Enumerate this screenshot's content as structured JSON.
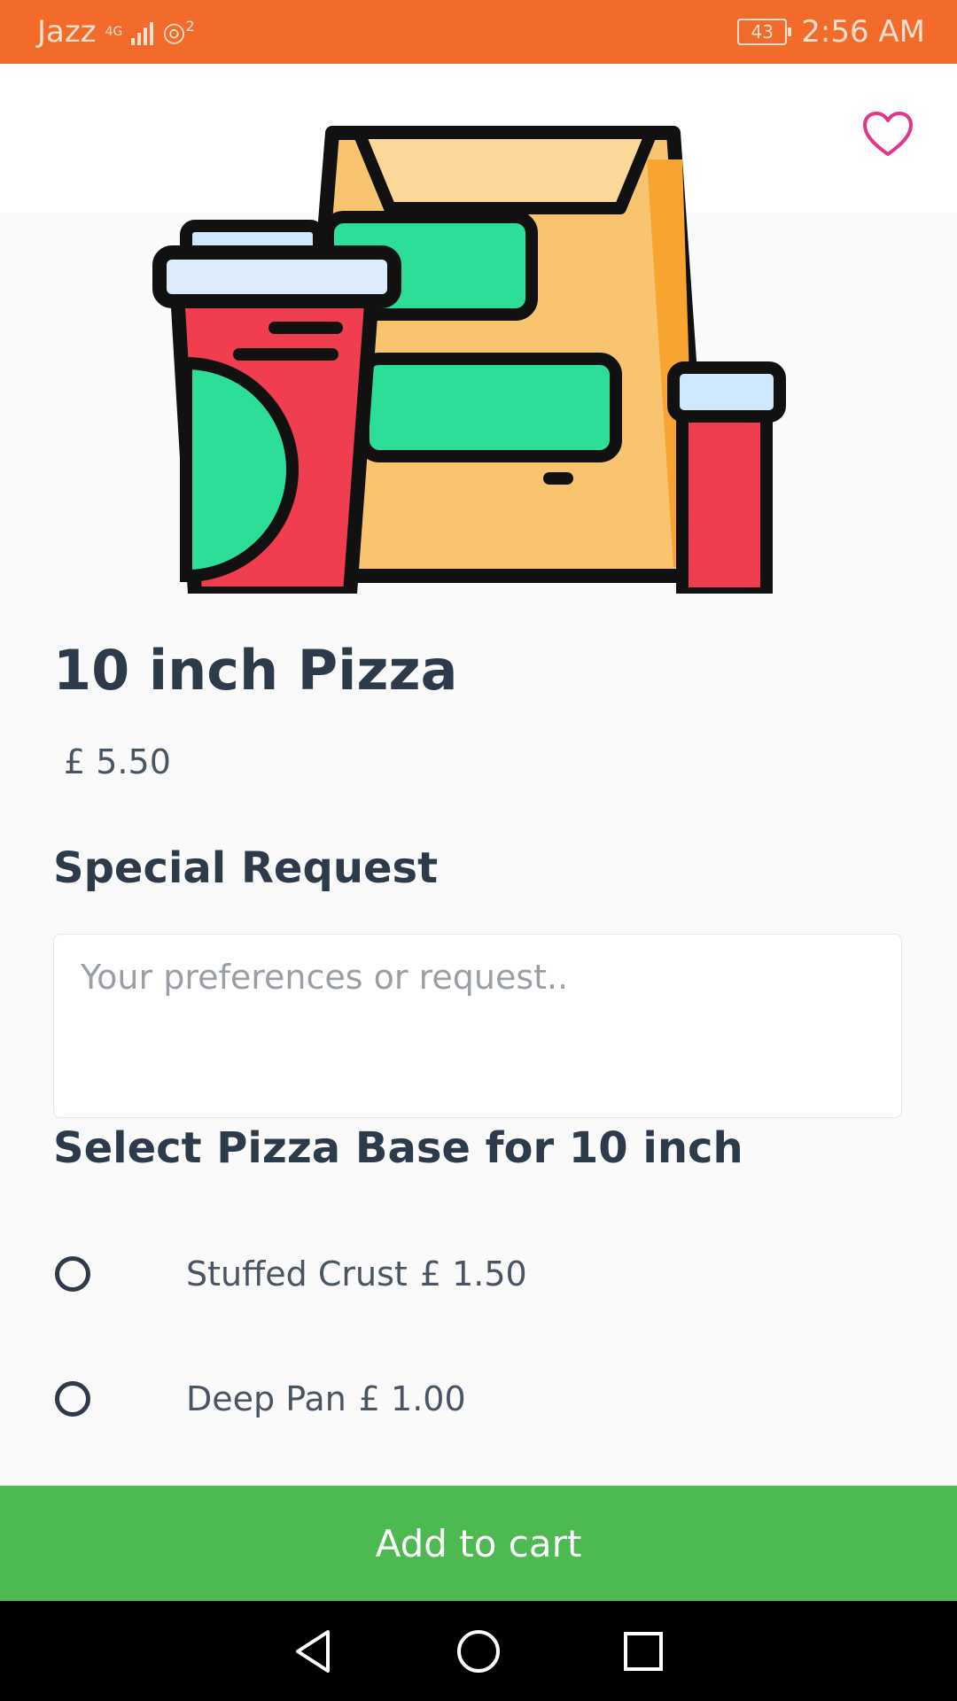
{
  "status_bar": {
    "carrier": "Jazz",
    "network": "4G",
    "hotspot_count": "2",
    "battery": "43",
    "time": "2:56 AM"
  },
  "product": {
    "image_icon": "food-takeaway-bag-illustration",
    "favorite_icon": "heart-outline-icon",
    "name": "10 inch Pizza",
    "price": "£ 5.50"
  },
  "special_request": {
    "heading": "Special Request",
    "placeholder": "Your preferences or request..",
    "value": ""
  },
  "pizza_base": {
    "heading": "Select Pizza Base for 10 inch",
    "options": [
      {
        "name": "Stuffed Crust",
        "price": "£ 1.50",
        "selected": false
      },
      {
        "name": "Deep Pan",
        "price": "£ 1.00",
        "selected": false
      }
    ]
  },
  "actions": {
    "add_to_cart": "Add to cart"
  },
  "colors": {
    "status_bar": "#f26b2a",
    "accent_heart": "#e0368c",
    "cart_button": "#4cba50",
    "text_dark": "#2c3a4a"
  },
  "nav_bar": {
    "icons": [
      "back-icon",
      "home-icon",
      "recents-icon"
    ]
  }
}
